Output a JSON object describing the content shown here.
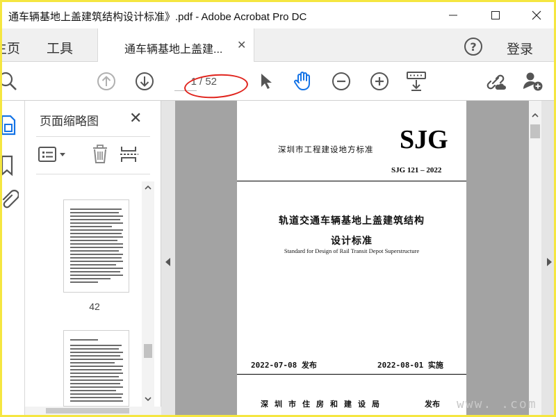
{
  "window": {
    "title": "通车辆基地上盖建筑结构设计标准》.pdf - Adobe Acrobat Pro DC"
  },
  "tabbar": {
    "home_label": "主页",
    "tools_label": "工具",
    "doc_tab_label": "通车辆基地上盖建...",
    "login_label": "登录"
  },
  "toolbar": {
    "current_page": "1",
    "total_pages": "/ 52"
  },
  "thumbnail_panel": {
    "title": "页面缩略图",
    "thumbs": [
      {
        "page_number": "42"
      },
      {
        "page_number": ""
      }
    ]
  },
  "document": {
    "authority": "深圳市工程建设地方标准",
    "logo": "SJG",
    "code": "SJG 121 – 2022",
    "title_line1": "轨道交通车辆基地上盖建筑结构",
    "title_line2": "设计标准",
    "title_en": "Standard for Design of Rail Transit Depot Superstructure",
    "publish_date": "2022-07-08  发布",
    "effective_date": "2022-08-01  实施",
    "publisher": "深圳市住房和建设局",
    "publisher_suffix": "发布"
  },
  "watermark": "www.      .com",
  "icons": {
    "minimize": "minimize-icon",
    "maximize": "maximize-icon",
    "close": "close-icon",
    "help": "help-icon",
    "search": "search-icon",
    "prev_page": "arrow-up-circle-icon",
    "next_page": "arrow-down-circle-icon",
    "select": "cursor-arrow-icon",
    "hand": "hand-icon",
    "zoom_out": "zoom-out-icon",
    "zoom_in": "zoom-in-icon",
    "scroll_mode": "scroll-mode-icon",
    "share_link": "link-cloud-icon",
    "add_user": "add-user-icon"
  },
  "colors": {
    "accent_blue": "#1473e6",
    "annotation_red": "#e0231c",
    "frame_yellow": "#f5e640"
  }
}
